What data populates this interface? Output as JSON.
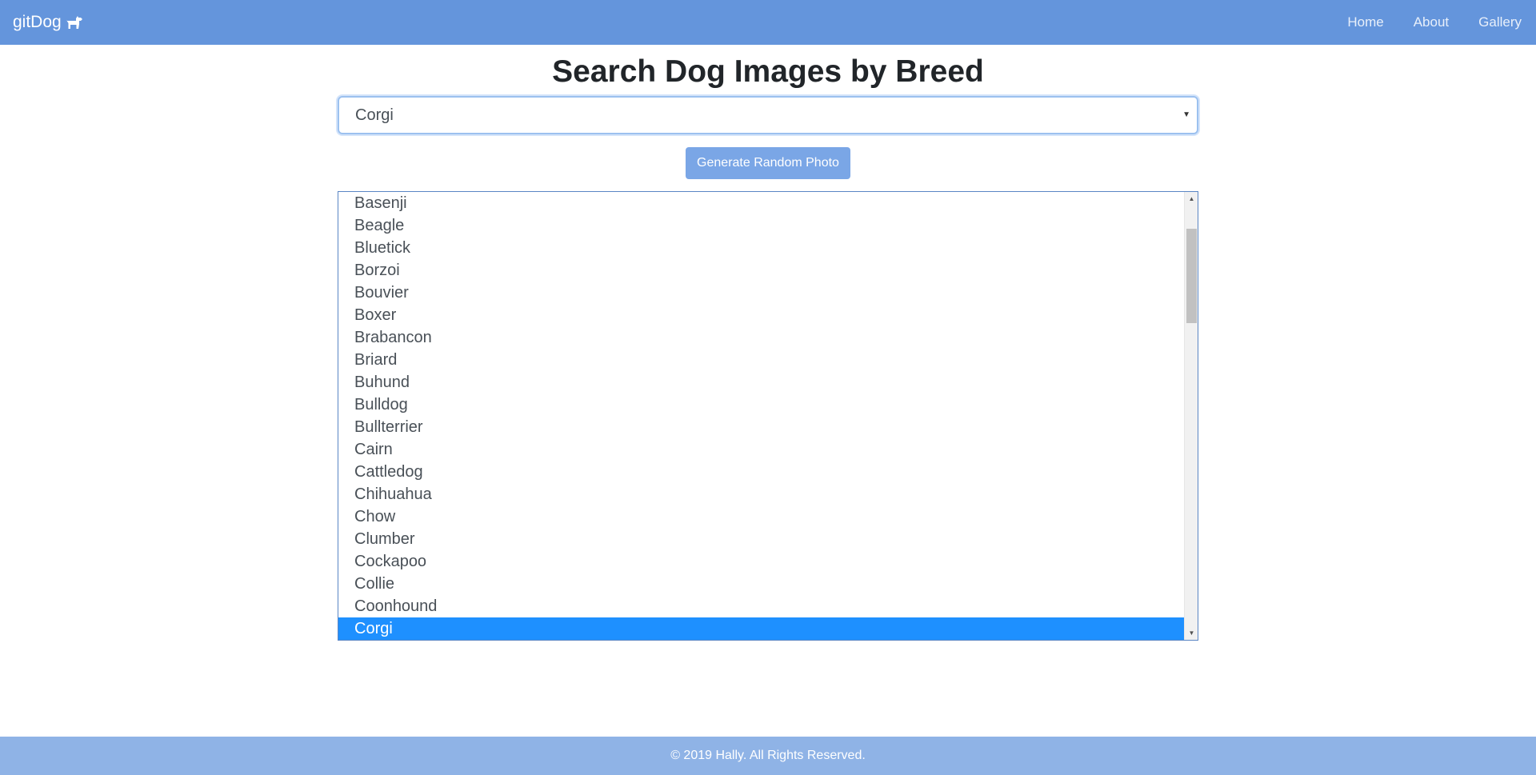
{
  "navbar": {
    "brand": "gitDog",
    "brand_icon": "dog-icon",
    "links": [
      "Home",
      "About",
      "Gallery"
    ]
  },
  "main": {
    "title": "Search Dog Images by Breed",
    "select": {
      "value": "Corgi"
    },
    "button_label": "Generate Random Photo",
    "breed_list": {
      "items": [
        "Basenji",
        "Beagle",
        "Bluetick",
        "Borzoi",
        "Bouvier",
        "Boxer",
        "Brabancon",
        "Briard",
        "Buhund",
        "Bulldog",
        "Bullterrier",
        "Cairn",
        "Cattledog",
        "Chihuahua",
        "Chow",
        "Clumber",
        "Cockapoo",
        "Collie",
        "Coonhound",
        "Corgi"
      ],
      "selected": "Corgi"
    }
  },
  "footer": {
    "text": "© 2019 Hally. All Rights Reserved."
  },
  "colors": {
    "navbar": "#6495dc",
    "button": "#7aa6e6",
    "selected": "#1e90ff",
    "footer": "#8fb3e6"
  }
}
